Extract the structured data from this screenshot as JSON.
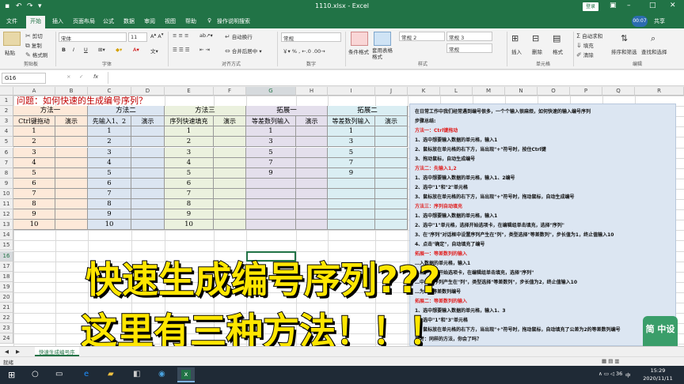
{
  "app": {
    "title": "1110.xlsx - Excel",
    "login": "登录",
    "share": "共享",
    "avatar": "00:07"
  },
  "tabs": [
    "文件",
    "开始",
    "插入",
    "页面布局",
    "公式",
    "数据",
    "审阅",
    "视图",
    "帮助"
  ],
  "tellme": "操作说明搜索",
  "ribbon": {
    "clipboard": {
      "cut": "剪切",
      "copy": "复制",
      "painter": "格式刷",
      "label": "剪贴板",
      "paste": "粘贴"
    },
    "font": {
      "name": "宋体",
      "size": "11",
      "label": "字体",
      "bold": "B",
      "italic": "I",
      "underline": "U"
    },
    "align": {
      "wrap": "自动换行",
      "merge": "合并后居中",
      "label": "对齐方式"
    },
    "number": {
      "format": "常规",
      "label": "数字"
    },
    "styles": {
      "cond": "条件格式",
      "table": "套用表格格式",
      "s2": "常规 2",
      "s3": "常规 3",
      "s": "常规",
      "label": "样式"
    },
    "cells": {
      "insert": "插入",
      "delete": "删除",
      "format": "格式",
      "label": "单元格"
    },
    "edit": {
      "autosum": "自动求和",
      "fill": "填充",
      "clear": "清除",
      "sort": "排序和筛选",
      "find": "查找和选择",
      "label": "编辑"
    }
  },
  "formula": {
    "namebox": "G16",
    "fx": "fx",
    "x": "×",
    "check": "✓"
  },
  "columns": [
    "A",
    "B",
    "C",
    "D",
    "E",
    "F",
    "G",
    "H",
    "I",
    "J",
    "K",
    "L",
    "M",
    "N",
    "O",
    "P",
    "Q",
    "R"
  ],
  "rows": [
    "1",
    "2",
    "3",
    "4",
    "5",
    "6",
    "7",
    "8",
    "9",
    "10",
    "11",
    "12",
    "13",
    "14",
    "15",
    "16",
    "17",
    "18",
    "19",
    "20",
    "21",
    "22",
    "23",
    "24"
  ],
  "sheet": {
    "title": "问题：如何快速的生成编号序列？",
    "headers": [
      "方法一",
      "方法二",
      "方法三",
      "拓展一",
      "拓展二"
    ],
    "sub": [
      "Ctrl键拖动",
      "演示",
      "先输入1、2",
      "演示",
      "序列快速填充",
      "演示",
      "等差数列输入",
      "演示",
      "等差数列输入",
      "演示"
    ],
    "colA": [
      "1",
      "2",
      "3",
      "4",
      "5",
      "6",
      "7",
      "8",
      "9",
      "10"
    ],
    "colC": [
      "1",
      "2",
      "3",
      "4",
      "5",
      "6",
      "7",
      "8",
      "9",
      "10"
    ],
    "colE": [
      "1",
      "2",
      "3",
      "4",
      "5",
      "6",
      "7",
      "8",
      "9",
      "10"
    ],
    "colG": [
      "1",
      "3",
      "5",
      "7",
      "9"
    ],
    "colI": [
      "1",
      "3",
      "5",
      "7",
      "9"
    ]
  },
  "panel": [
    {
      "t": "在日常工作中我们经常遇到编号很多，一个个输入很麻烦，如何快速的输入编号序列",
      "red": false
    },
    {
      "t": "步骤总结:",
      "red": false
    },
    {
      "t": "方法一：Ctrl键拖动",
      "red": true
    },
    {
      "t": "1、选中想要输入数据的单元格，输入1",
      "red": false
    },
    {
      "t": "2、鼠标放在单元格的右下方，当出现\"+\"符号时，按住Ctrl键",
      "red": false
    },
    {
      "t": "3、拖动鼠标，自动生成编号",
      "red": false
    },
    {
      "t": "方法二：先输入1,2",
      "red": true
    },
    {
      "t": "1、选中想要输入数据的单元格，输入1、2编号",
      "red": false
    },
    {
      "t": "2、选中\"1\"和\"2\"单元格",
      "red": false
    },
    {
      "t": "3、鼠标放在单元格的右下方，当出现\"+\"符号时，拖动鼠标，自动生成编号",
      "red": false
    },
    {
      "t": "方法三：序列自动填充",
      "red": true
    },
    {
      "t": "1、选中想要输入数据的单元格，输入1",
      "red": false
    },
    {
      "t": "2、选中\"1\"单元格，选择开始选项卡，在编辑组单击填充，选择\"序列\"",
      "red": false
    },
    {
      "t": "3、在\"序列\"对话框中设置序列产生在\"列\"，类型选择\"等差数列\"，步长值为1，终止值输入10",
      "red": false
    },
    {
      "t": "4、点击\"确定\"，自动填充了编号",
      "red": false
    },
    {
      "t": "拓展一：等差数列的输入",
      "red": true
    },
    {
      "t": "…入数据的单元格，输入1",
      "red": false
    },
    {
      "t": "…格，选择开始选项卡，在编辑组单击填充，选择\"序列\"",
      "red": false
    },
    {
      "t": "…中设置序列产生在\"列\"，类型选择\"等差数列\"，步长值为2，终止值输入10",
      "red": false
    },
    {
      "t": "…为2的等差数列编号",
      "red": false
    },
    {
      "t": "拓展二：等差数列的输入",
      "red": true
    },
    {
      "t": "1、选中想要输入数据的单元格，输入1、3",
      "red": false
    },
    {
      "t": "2、选中\"1\"和\"3\"单元格",
      "red": false
    },
    {
      "t": "3、鼠标放在单元格的右下方，当出现\"+\"符号时，拖动鼠标，自动填充了公差为2的等差数列编号",
      "red": false
    },
    {
      "t": "思考：同样的方法，你会了吗？",
      "red": false
    }
  ],
  "overlay": {
    "line1": "快速生成编号序列???",
    "line2": "这里有三种方法！！！"
  },
  "sheettab": "快速生成编号序",
  "status": {
    "ready": "就绪",
    "zoom": "100%"
  },
  "taskbar": {
    "time": "15:29",
    "date": "2020/11/11",
    "lang": "中",
    "num": "36"
  },
  "watermark": "简 中设"
}
